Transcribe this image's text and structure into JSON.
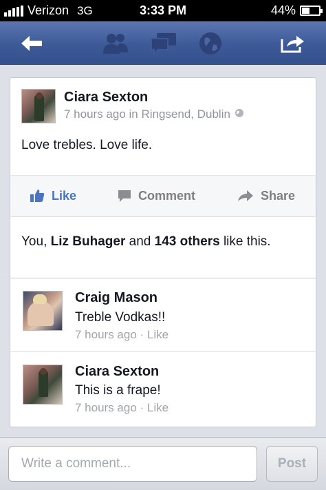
{
  "status_bar": {
    "carrier": "Verizon",
    "network": "3G",
    "time": "3:33 PM",
    "battery_text": "44%",
    "battery_level": 0.44
  },
  "nav": {
    "icons": [
      "back-arrow-icon",
      "friends-icon",
      "messages-icon",
      "globe-icon",
      "share-icon"
    ]
  },
  "post": {
    "author": "Ciara Sexton",
    "meta": "7 hours ago in Ringsend, Dublin",
    "text": "Love trebles. Love life."
  },
  "actions": {
    "like": "Like",
    "comment": "Comment",
    "share": "Share",
    "like_color": "#4b73c0"
  },
  "likes": {
    "prefix": "You, ",
    "name": "Liz Buhager",
    "middle": " and ",
    "others": "143 others",
    "suffix": " like this."
  },
  "comments": [
    {
      "author": "Craig Mason",
      "text": "Treble Vodkas!!",
      "time": "7 hours ago",
      "like": "Like"
    },
    {
      "author": "Ciara Sexton",
      "text": "This is a frape!",
      "time": "7 hours ago",
      "like": "Like"
    }
  ],
  "compose": {
    "placeholder": "Write a comment...",
    "post_label": "Post"
  },
  "colors": {
    "navbar": "#3d5a98",
    "accent": "#4b73c0"
  }
}
